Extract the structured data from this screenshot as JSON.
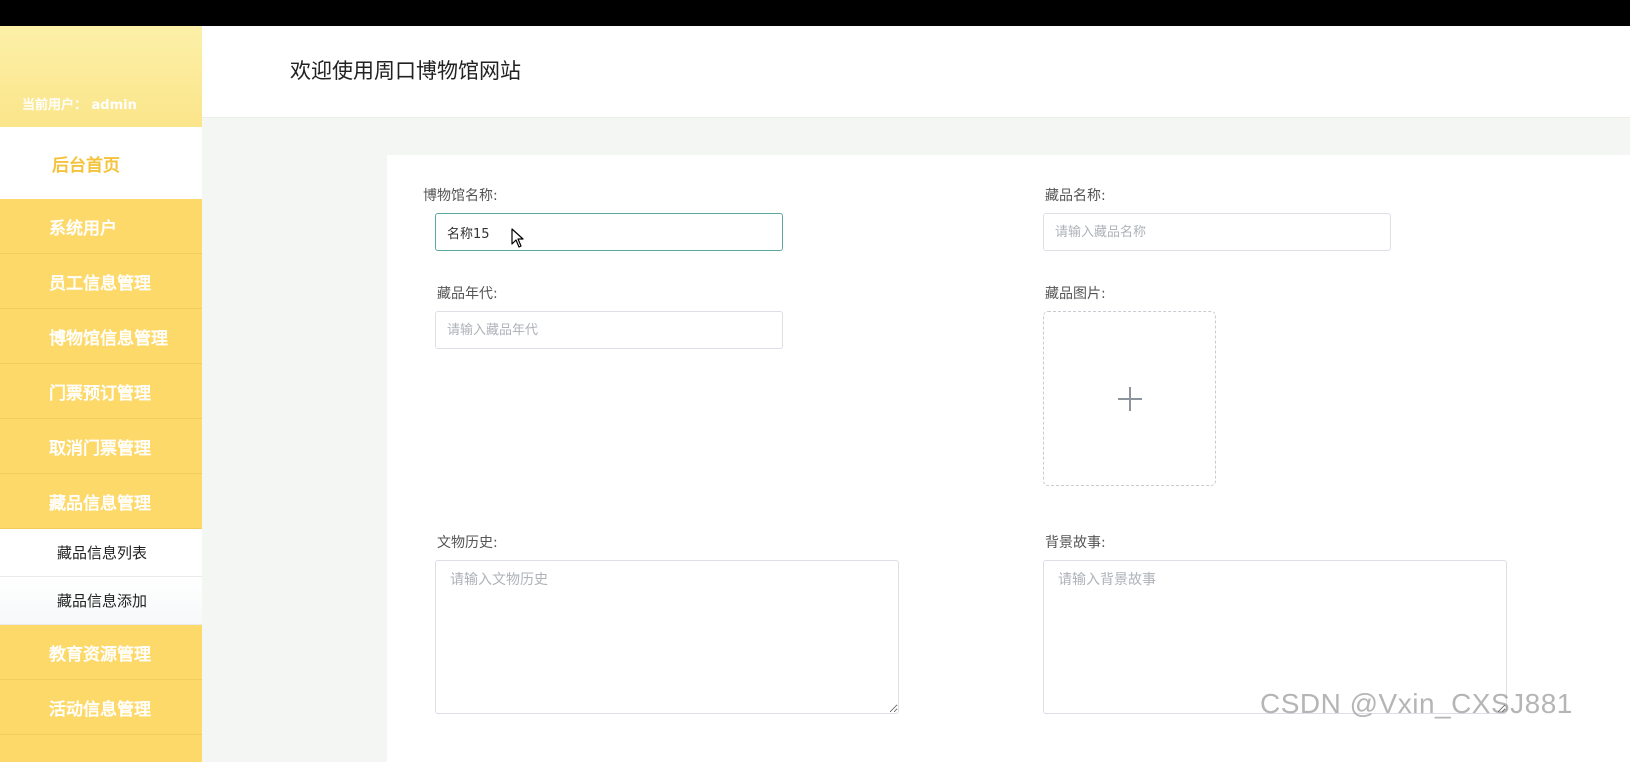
{
  "sidebar": {
    "current_user": "当前用户：  admin",
    "home": "后台首页",
    "items": [
      {
        "label": "系统用户"
      },
      {
        "label": "员工信息管理"
      },
      {
        "label": "博物馆信息管理"
      },
      {
        "label": "门票预订管理"
      },
      {
        "label": "取消门票管理"
      },
      {
        "label": "藏品信息管理"
      }
    ],
    "submenu": [
      {
        "label": "藏品信息列表"
      },
      {
        "label": "藏品信息添加"
      }
    ],
    "items_after": [
      {
        "label": "教育资源管理"
      },
      {
        "label": "活动信息管理"
      }
    ]
  },
  "header": {
    "title": "欢迎使用周口博物馆网站"
  },
  "form": {
    "museum_name": {
      "label": "博物馆名称:",
      "value": "名称15"
    },
    "item_name": {
      "label": "藏品名称:",
      "placeholder": "请输入藏品名称"
    },
    "item_era": {
      "label": "藏品年代:",
      "placeholder": "请输入藏品年代"
    },
    "item_image": {
      "label": "藏品图片:"
    },
    "history": {
      "label": "文物历史:",
      "placeholder": "请输入文物历史"
    },
    "story": {
      "label": "背景故事:",
      "placeholder": "请输入背景故事"
    }
  },
  "watermark": "CSDN @Vxin_CXSJ881",
  "colors": {
    "sidebar_bg": "#fdd96a",
    "home_text": "#f5c33b",
    "focus_border": "#5aa9a0"
  }
}
